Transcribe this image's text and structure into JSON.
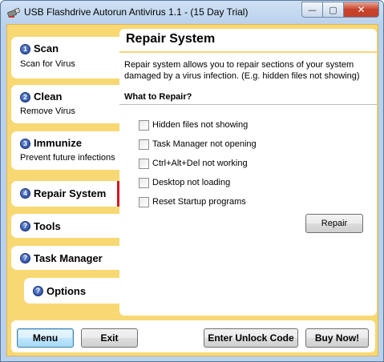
{
  "window": {
    "title": "USB Flashdrive Autorun Antivirus 1.1 - (15 Day Trial)",
    "minimize_glyph": "—",
    "maximize_glyph": "▢",
    "close_glyph": "✕"
  },
  "colors": {
    "accent_background": "#f8d873",
    "active_marker": "#d3161f",
    "number_badge": "#1d3f95"
  },
  "sidebar": {
    "items": [
      {
        "number": "1",
        "title": "Scan",
        "subtitle": "Scan for Virus",
        "icon": "number-badge"
      },
      {
        "number": "2",
        "title": "Clean",
        "subtitle": "Remove Virus",
        "icon": "number-badge"
      },
      {
        "number": "3",
        "title": "Immunize",
        "subtitle": "Prevent future infections",
        "icon": "number-badge"
      },
      {
        "number": "4",
        "title": "Repair System",
        "subtitle": "",
        "icon": "number-badge",
        "active": true
      },
      {
        "title": "Tools",
        "icon": "help-icon",
        "glyph": "?"
      },
      {
        "title": "Task Manager",
        "icon": "help-icon",
        "glyph": "?"
      },
      {
        "title": "Options",
        "icon": "help-icon",
        "glyph": "?"
      }
    ]
  },
  "main": {
    "title": "Repair System",
    "description": "Repair system allows you to repair sections of your system damaged by a virus infection. (E.g. hidden files not showing)",
    "section_title": "What to Repair?",
    "options": [
      {
        "label": "Hidden files not showing",
        "checked": false
      },
      {
        "label": "Task Manager not opening",
        "checked": false
      },
      {
        "label": "Ctrl+Alt+Del not working",
        "checked": false
      },
      {
        "label": "Desktop not loading",
        "checked": false
      },
      {
        "label": "Reset Startup programs",
        "checked": false
      }
    ],
    "repair_button": "Repair"
  },
  "footer": {
    "menu_button": "Menu",
    "exit_button": "Exit",
    "unlock_button": "Enter Unlock Code",
    "buy_button": "Buy Now!"
  }
}
